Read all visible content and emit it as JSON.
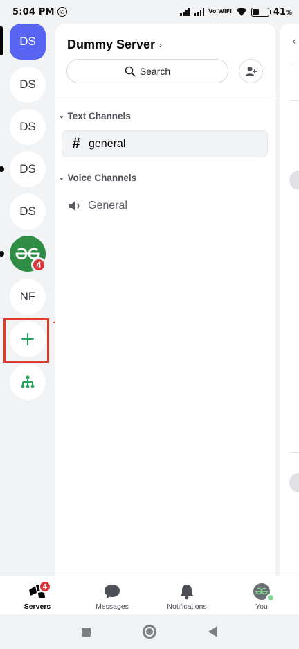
{
  "status_bar": {
    "time": "5:04 PM",
    "network_label": "Vo WiFi",
    "battery_percent": "41",
    "battery_unit": "%",
    "battery_level": 0.41
  },
  "server_rail": {
    "servers": [
      {
        "label": "DS",
        "active": true
      },
      {
        "label": "DS"
      },
      {
        "label": "DS"
      },
      {
        "label": "DS",
        "unread": true
      },
      {
        "label": "DS"
      },
      {
        "label": "GfG",
        "unread": true,
        "badge": "4"
      },
      {
        "label": "NF"
      }
    ],
    "add_server_icon": "plus-icon",
    "discover_icon": "hub-icon",
    "annotation_color": "#e23b26"
  },
  "channel_panel": {
    "server_name": "Dummy Server",
    "search_label": "Search",
    "categories": [
      {
        "name": "Text Channels",
        "channels": [
          {
            "name": "general",
            "type": "text",
            "selected": true
          }
        ]
      },
      {
        "name": "Voice Channels",
        "channels": [
          {
            "name": "General",
            "type": "voice"
          }
        ]
      }
    ]
  },
  "bottom_nav": {
    "tabs": [
      {
        "label": "Servers",
        "icon": "servers-icon",
        "badge": "4",
        "active": true
      },
      {
        "label": "Messages",
        "icon": "chat-bubble-icon"
      },
      {
        "label": "Notifications",
        "icon": "bell-icon"
      },
      {
        "label": "You",
        "icon": "avatar"
      }
    ]
  },
  "colors": {
    "accent": "#5865f2",
    "badge": "#da373c",
    "green": "#23a55a"
  }
}
